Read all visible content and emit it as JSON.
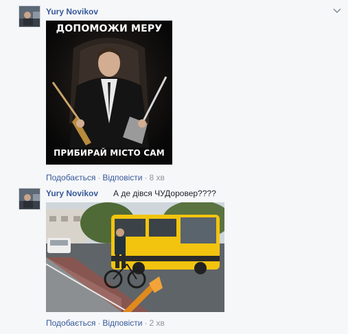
{
  "comments": [
    {
      "author": "Yury Novikov",
      "text": "",
      "image_caption_top": "ДОПОМОЖИ МЕРУ",
      "image_caption_bottom": "ПРИБИРАЙ МІСТО САМ",
      "actions": {
        "like": "Подобається",
        "reply": "Відповісти",
        "time": "8 хв"
      }
    },
    {
      "author": "Yury Novikov",
      "text": "А де дівся ЧУДоровер????",
      "actions": {
        "like": "Подобається",
        "reply": "Відповісти",
        "time": "2 хв"
      }
    }
  ],
  "icons": {
    "menu": "chevron-down-icon"
  },
  "colors": {
    "link": "#365899",
    "meta": "#90949c",
    "background": "#f6f7f9",
    "bus": "#f2c40f"
  }
}
